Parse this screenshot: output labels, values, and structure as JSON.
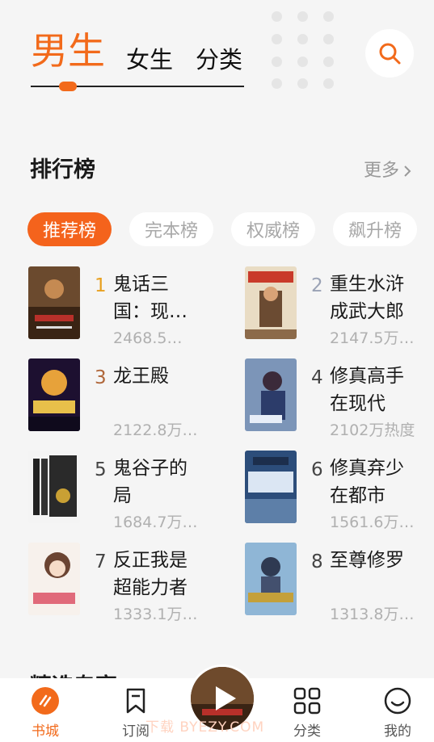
{
  "top_tabs": {
    "active": "男生",
    "girls": "女生",
    "category": "分类"
  },
  "ranking": {
    "title": "排行榜",
    "more": "更多",
    "chips": [
      "推荐榜",
      "完本榜",
      "权威榜",
      "飙升榜"
    ],
    "books": [
      {
        "rank": "1",
        "title": "鬼话三国：现…",
        "heat": "2468.5…"
      },
      {
        "rank": "2",
        "title": "重生水浒成武大郎",
        "heat": "2147.5万…"
      },
      {
        "rank": "3",
        "title": "龙王殿",
        "heat": "2122.8万…"
      },
      {
        "rank": "4",
        "title": "修真高手在现代",
        "heat": "2102万热度"
      },
      {
        "rank": "5",
        "title": "鬼谷子的局",
        "heat": "1684.7万…"
      },
      {
        "rank": "6",
        "title": "修真弃少在都市",
        "heat": "1561.6万…"
      },
      {
        "rank": "7",
        "title": "反正我是超能力者",
        "heat": "1333.1万…"
      },
      {
        "rank": "8",
        "title": "至尊修罗",
        "heat": "1313.8万…"
      }
    ]
  },
  "next_section_title": "精选专享",
  "bottom_nav": [
    {
      "label": "书城",
      "icon": "bookstore-icon"
    },
    {
      "label": "订阅",
      "icon": "bookmark-icon"
    },
    {
      "label": "分类",
      "icon": "grid-icon"
    },
    {
      "label": "我的",
      "icon": "smiley-icon"
    }
  ],
  "watermark": "下载 BYEZY.COM",
  "colors": {
    "accent": "#f26a1b",
    "gold": "#e8a020",
    "silver": "#9aa2b5",
    "bronze": "#b0673a"
  }
}
